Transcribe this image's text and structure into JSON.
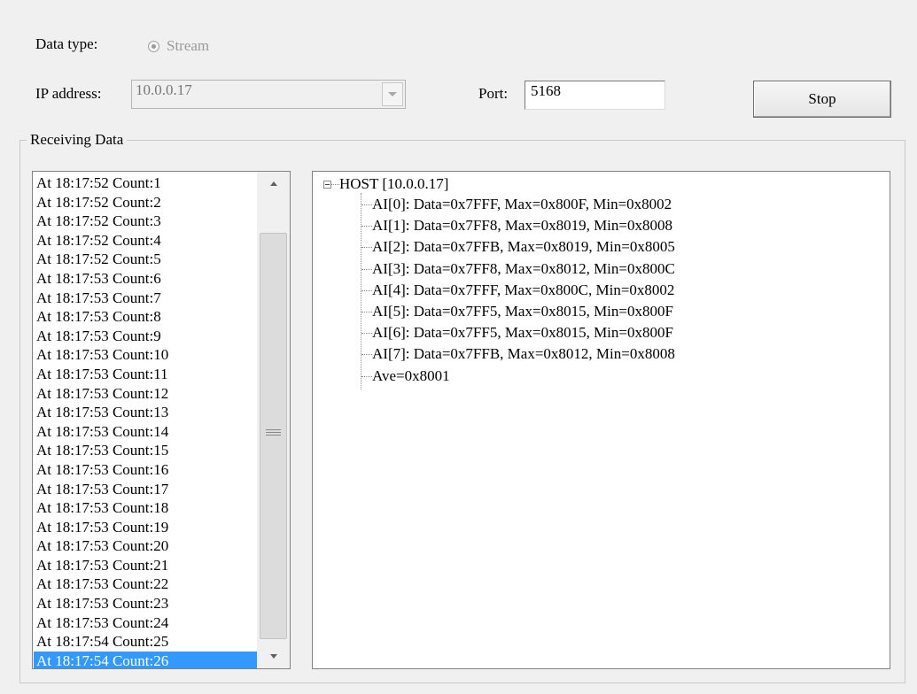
{
  "form": {
    "data_type_label": "Data type:",
    "data_type_option": "Stream",
    "ip_label": "IP address:",
    "ip_value": "10.0.0.17",
    "port_label": "Port:",
    "port_value": "5168",
    "stop_label": "Stop"
  },
  "receiving": {
    "title": "Receiving Data",
    "list": [
      "At 18:17:52 Count:1",
      "At 18:17:52 Count:2",
      "At 18:17:52 Count:3",
      "At 18:17:52 Count:4",
      "At 18:17:52 Count:5",
      "At 18:17:53 Count:6",
      "At 18:17:53 Count:7",
      "At 18:17:53 Count:8",
      "At 18:17:53 Count:9",
      "At 18:17:53 Count:10",
      "At 18:17:53 Count:11",
      "At 18:17:53 Count:12",
      "At 18:17:53 Count:13",
      "At 18:17:53 Count:14",
      "At 18:17:53 Count:15",
      "At 18:17:53 Count:16",
      "At 18:17:53 Count:17",
      "At 18:17:53 Count:18",
      "At 18:17:53 Count:19",
      "At 18:17:53 Count:20",
      "At 18:17:53 Count:21",
      "At 18:17:53 Count:22",
      "At 18:17:53 Count:23",
      "At 18:17:53 Count:24",
      "At 18:17:54 Count:25",
      "At 18:17:54 Count:26"
    ],
    "selected_index": 25,
    "tree": {
      "root": "HOST [10.0.0.17]",
      "children": [
        "AI[0]: Data=0x7FFF, Max=0x800F, Min=0x8002",
        "AI[1]: Data=0x7FF8, Max=0x8019, Min=0x8008",
        "AI[2]: Data=0x7FFB, Max=0x8019, Min=0x8005",
        "AI[3]: Data=0x7FF8, Max=0x8012, Min=0x800C",
        "AI[4]: Data=0x7FFF, Max=0x800C, Min=0x8002",
        "AI[5]: Data=0x7FF5, Max=0x8015, Min=0x800F",
        "AI[6]: Data=0x7FF5, Max=0x8015, Min=0x800F",
        "AI[7]: Data=0x7FFB, Max=0x8012, Min=0x8008",
        "Ave=0x8001"
      ]
    }
  },
  "colors": {
    "selection": "#3399ff",
    "background": "#f0f0f0"
  }
}
